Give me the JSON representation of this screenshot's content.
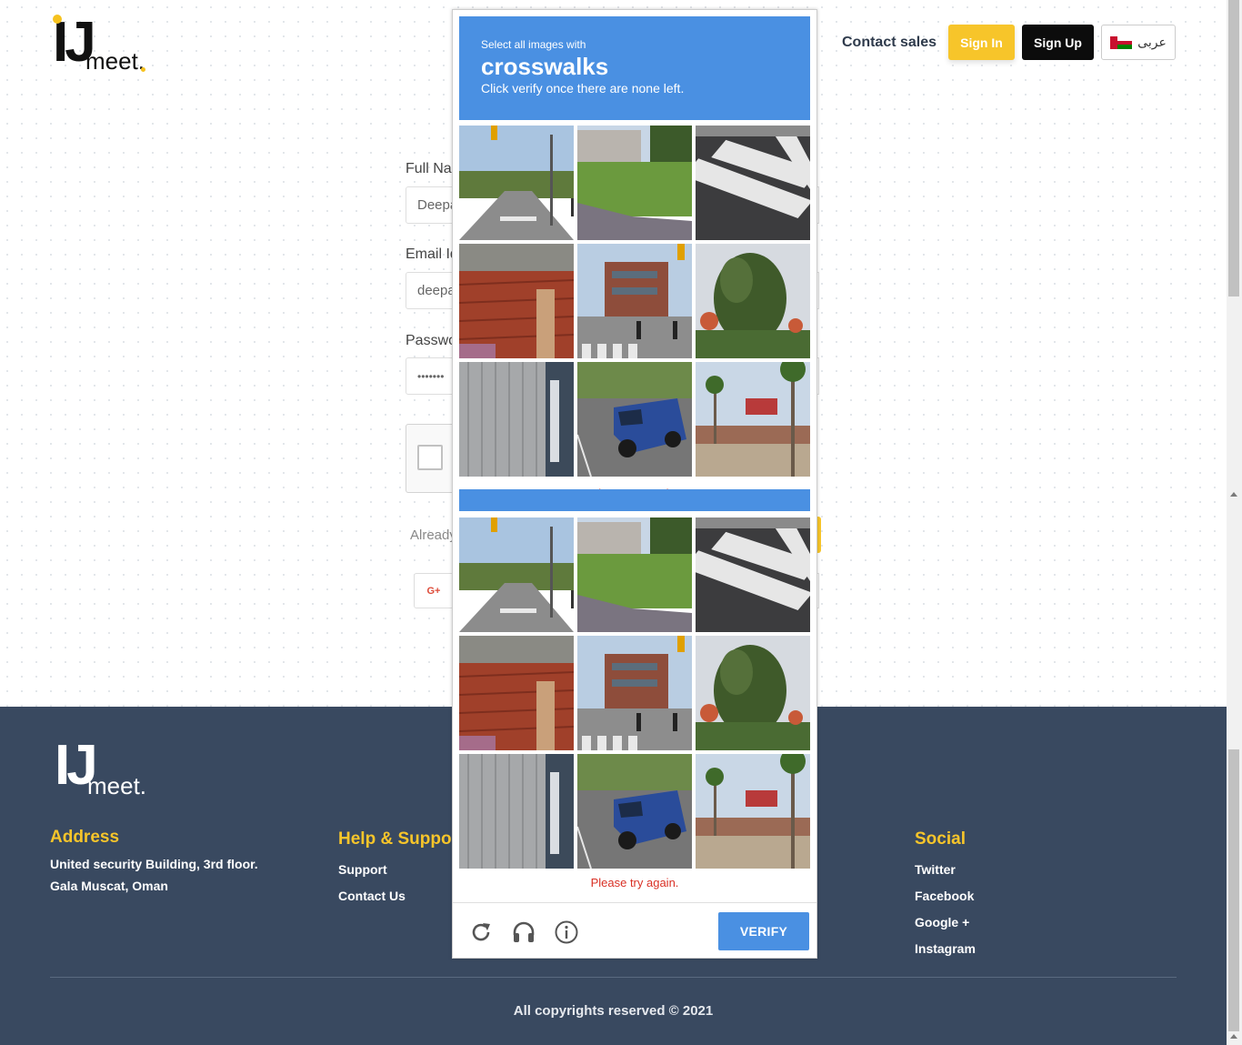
{
  "header": {
    "logo_ij": "IJ",
    "logo_meet": "meet.",
    "contact_sales": "Contact sales",
    "sign_in": "Sign In",
    "sign_up": "Sign Up",
    "language": "عربى",
    "flag_icon": "oman-flag-icon"
  },
  "form": {
    "full_name_label": "Full Nar",
    "full_name_value": "Deepa",
    "email_label": "Email Id",
    "email_value": "deepa",
    "password_label": "Passwo",
    "password_value": "•••••••",
    "already_text": "Already",
    "google_button": "G+"
  },
  "challenge": {
    "instruction": "Select all images with",
    "target": "crosswalks",
    "sub_instruction": "Click verify once there are none left.",
    "ghost_error": "Please try again.",
    "error_message": "Please try again.",
    "verify_label": "VERIFY",
    "icons": [
      "reload-icon",
      "audio-icon",
      "info-icon"
    ],
    "tiles": [
      "street-with-traffic-light",
      "lawn-and-house",
      "crosswalk-stripes",
      "red-wall-closeup",
      "building-with-pedestrians-crosswalk",
      "palm-tree",
      "grey-wall",
      "blue-pickup-truck",
      "roadside-restaurant-palms"
    ],
    "accent_color": "#4a90e2"
  },
  "footer": {
    "logo_ij": "IJ",
    "logo_meet": "meet.",
    "address_heading": "Address",
    "address_line1": "United security Building, 3rd floor.",
    "address_line2": "Gala Muscat, Oman",
    "help_heading": "Help & Suppor",
    "help_links": [
      "Support",
      "Contact Us"
    ],
    "social_heading": "Social",
    "social_links": [
      "Twitter",
      "Facebook",
      "Google +",
      "Instagram"
    ],
    "copyright": "All copyrights reserved © 2021"
  },
  "colors": {
    "brand_yellow": "#f7c52a",
    "footer_bg": "#394960",
    "error_red": "#d93025"
  }
}
